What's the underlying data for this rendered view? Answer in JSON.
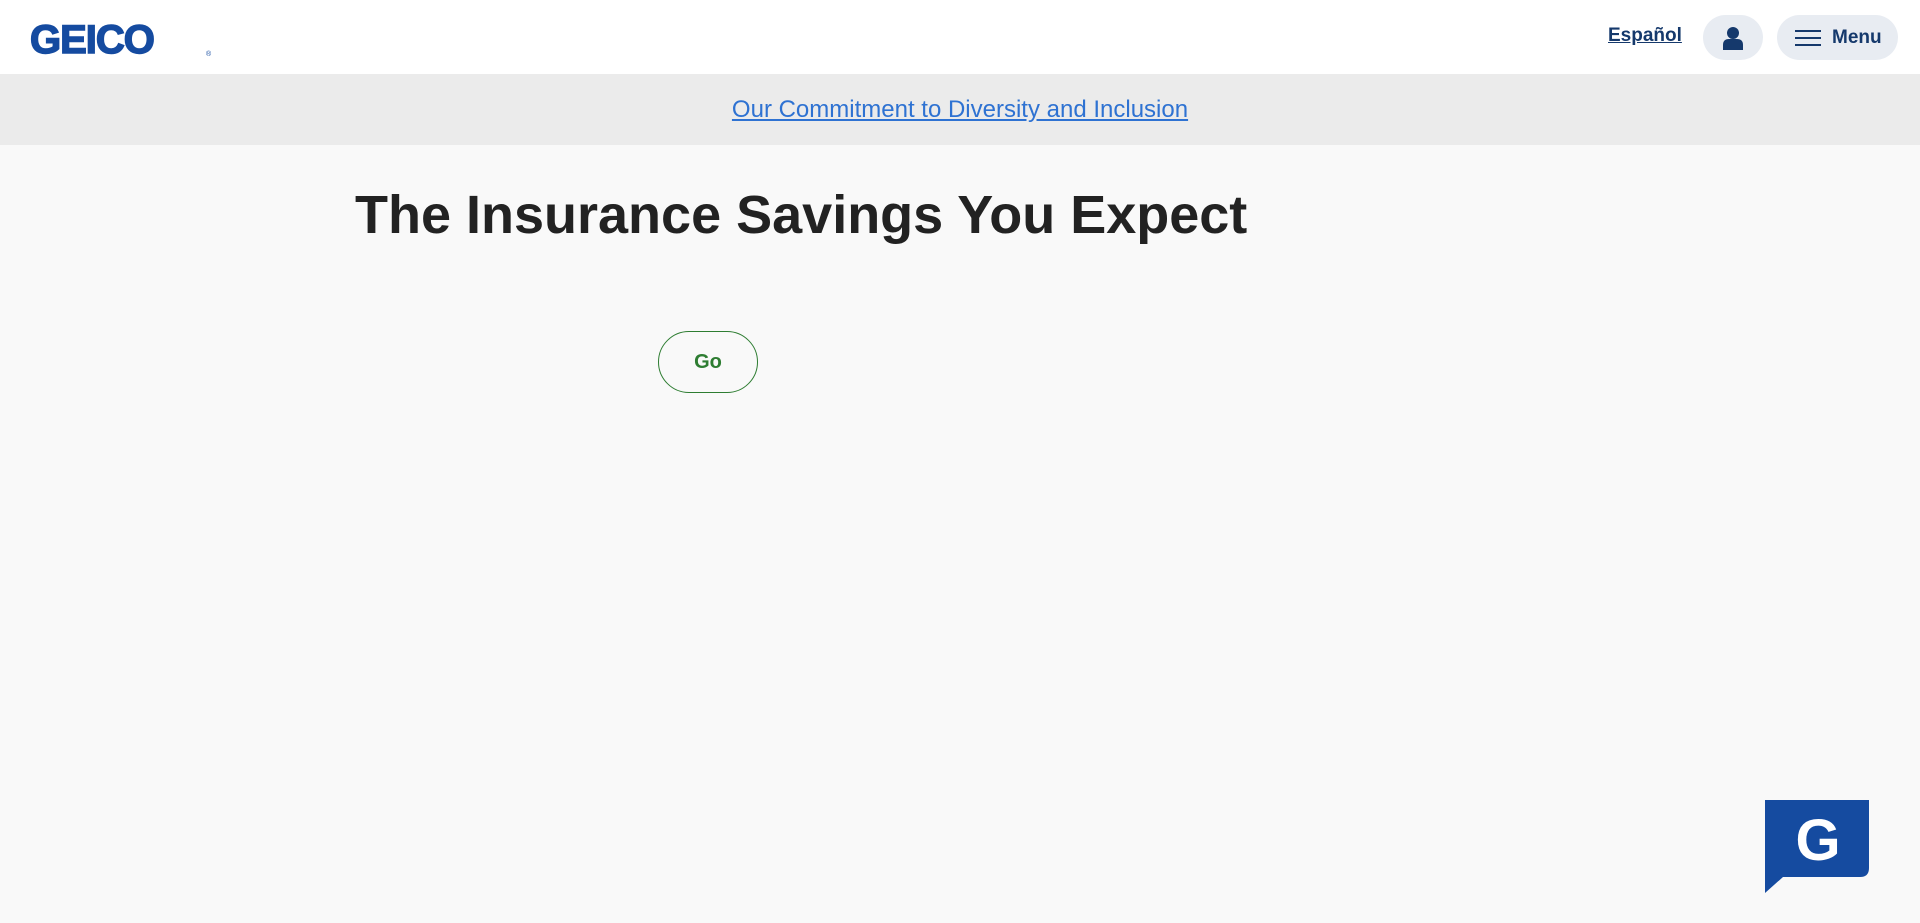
{
  "header": {
    "logo_text": "GEICO",
    "language_link": "Español",
    "account_icon": "person-icon",
    "menu_icon": "hamburger-icon",
    "menu_label": "Menu"
  },
  "banner": {
    "link_text": "Our Commitment to Diversity and Inclusion"
  },
  "hero": {
    "title": "The Insurance Savings You Expect",
    "go_label": "Go"
  },
  "chat": {
    "icon": "geico-g-chat-icon",
    "letter": "G"
  },
  "colors": {
    "brand_blue": "#15396c",
    "link_blue": "#2e72d2",
    "go_green": "#2e7d32",
    "logo_blue": "#154ba0"
  }
}
